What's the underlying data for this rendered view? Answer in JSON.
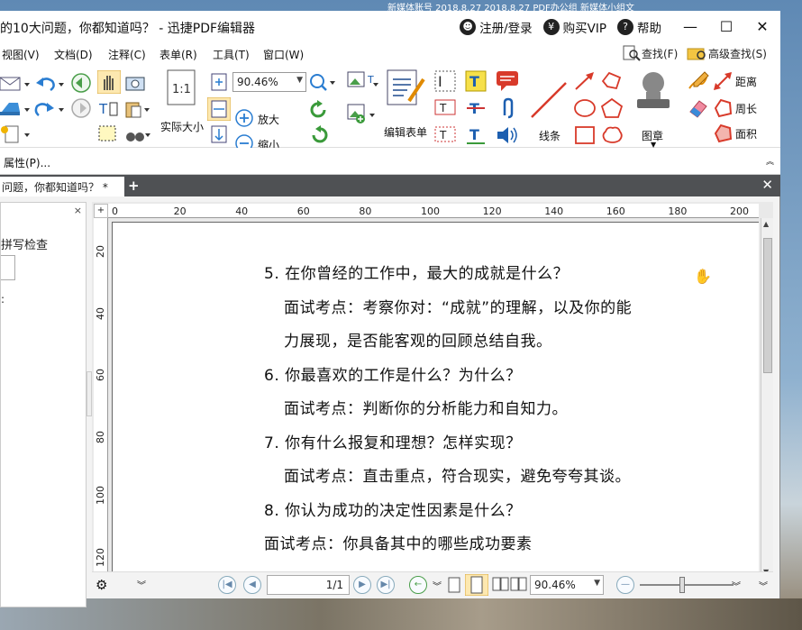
{
  "desktop": {
    "top_strip": "新媒体账号   2018.8.27   2018.8.27   PDF办公组   新媒体小组文"
  },
  "window": {
    "title": "的10大问题，你都知道吗？  -  迅捷PDF编辑器",
    "register_label": "注册/登录",
    "buy_vip_label": "购买VIP",
    "help_label": "帮助",
    "minimize": "—",
    "maximize": "☐",
    "close": "✕"
  },
  "menu": {
    "items": [
      "视图(V)",
      "文档(D)",
      "注释(C)",
      "表单(R)",
      "工具(T)",
      "窗口(W)"
    ],
    "find_label": "查找(F)",
    "advanced_find_label": "高级查找(S)"
  },
  "ribbon": {
    "actual_size_label": "实际大小",
    "zoom_value": "90.46%",
    "zoom_in_label": "放大",
    "zoom_out_label": "缩小",
    "edit_form_label": "编辑表单",
    "line_label": "线条",
    "stamp_label": "图章",
    "distance_label": "距离",
    "perimeter_label": "周长",
    "area_label": "面积"
  },
  "propbar": {
    "label": "属性(P)..."
  },
  "tabs": {
    "doc_tab_label": "问题，你都知道吗？ *",
    "tab_close_small": "✕",
    "add": "+",
    "close_all": "✕"
  },
  "sidepanel": {
    "close": "×",
    "spellcheck_label": "拼写检查",
    "colon": ":"
  },
  "ruler": {
    "h_ticks": [
      "0",
      "20",
      "40",
      "60",
      "80",
      "100",
      "120",
      "140",
      "160",
      "180",
      "200"
    ],
    "v_ticks": [
      "20",
      "40",
      "60",
      "80",
      "100",
      "120"
    ]
  },
  "document": {
    "lines": [
      "5. 在你曾经的工作中，最大的成就是什么？",
      "面试考点：考察你对：“成就”的理解，以及你的能",
      "力展现，是否能客观的回顾总结自我。",
      "6. 你最喜欢的工作是什么？为什么？",
      "面试考点：判断你的分析能力和自知力。",
      "7. 你有什么报复和理想？怎样实现？",
      "面试考点：直击重点，符合现实，避免夸夸其谈。",
      "8. 你认为成功的决定性因素是什么？",
      "面试考点：你具备其中的哪些成功要素"
    ]
  },
  "statusbar": {
    "page_value": "1/1",
    "zoom_value": "90.46%"
  }
}
